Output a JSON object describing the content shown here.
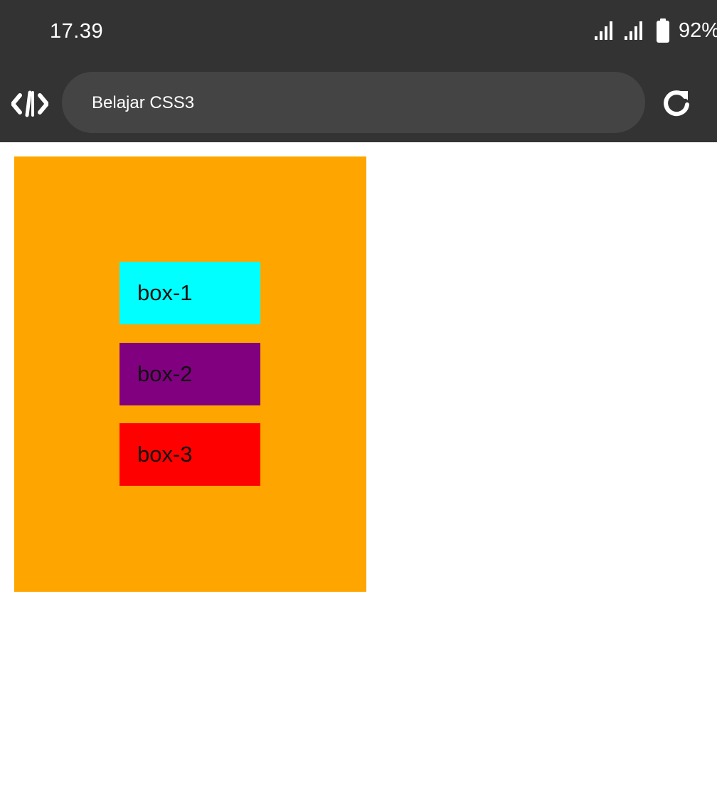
{
  "status_bar": {
    "time": "17.39",
    "battery_percent": "92%",
    "icons": [
      "signal-icon",
      "signal-icon",
      "battery-icon"
    ]
  },
  "toolbar": {
    "left_icon": "code-icon",
    "url_text": "Belajar CSS3",
    "right_icon": "reload-icon",
    "background": "#333333",
    "urlbar_background": "#444444"
  },
  "page": {
    "container_color": "#ffa500",
    "boxes": [
      {
        "label": "box-1",
        "color": "#00ffff"
      },
      {
        "label": "box-2",
        "color": "#800080"
      },
      {
        "label": "box-3",
        "color": "#ff0000"
      }
    ]
  }
}
